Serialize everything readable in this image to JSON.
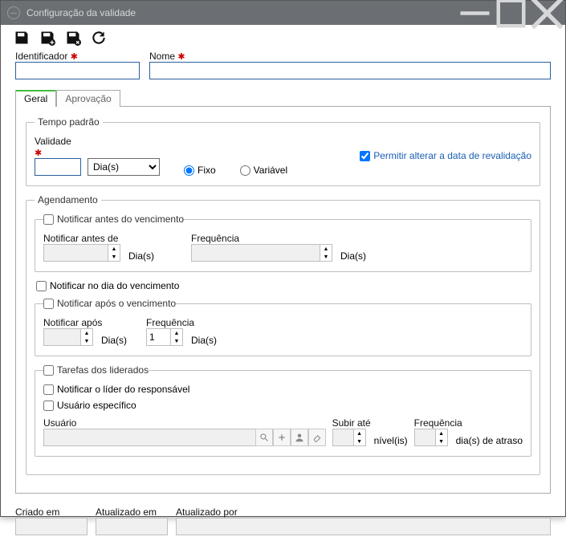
{
  "window": {
    "title": "Configuração da validade"
  },
  "fields": {
    "identificador": {
      "label": "Identificador"
    },
    "nome": {
      "label": "Nome"
    }
  },
  "tabs": {
    "geral": "Geral",
    "aprovacao": "Aprovação"
  },
  "tempo_padrao": {
    "legend": "Tempo padrão",
    "validade_label": "Validade",
    "unit_selected": "Dia(s)",
    "fixo": "Fixo",
    "variavel": "Variável",
    "permitir": "Permitir alterar a data de revalidação"
  },
  "agendamento": {
    "legend": "Agendamento",
    "notificar_antes_check": "Notificar antes do vencimento",
    "notificar_antes_label": "Notificar antes de",
    "frequencia_label": "Frequência",
    "dias_unit": "Dia(s)",
    "notificar_no_dia": "Notificar no dia do vencimento",
    "notificar_apos_check": "Notificar após o vencimento",
    "notificar_apos_label": "Notificar após",
    "apos_value": "",
    "apos_freq_value": "1",
    "tarefas_check": "Tarefas dos liderados",
    "notificar_lider": "Notificar o líder do responsável",
    "usuario_especifico": "Usuário específico",
    "usuario_label": "Usuário",
    "subir_label": "Subir até",
    "nivel_unit": "nível(is)",
    "freq2_label": "Frequência",
    "dias_atraso": "dia(s) de atraso"
  },
  "footer": {
    "criado_em": "Criado em",
    "atualizado_em": "Atualizado em",
    "atualizado_por": "Atualizado por"
  }
}
